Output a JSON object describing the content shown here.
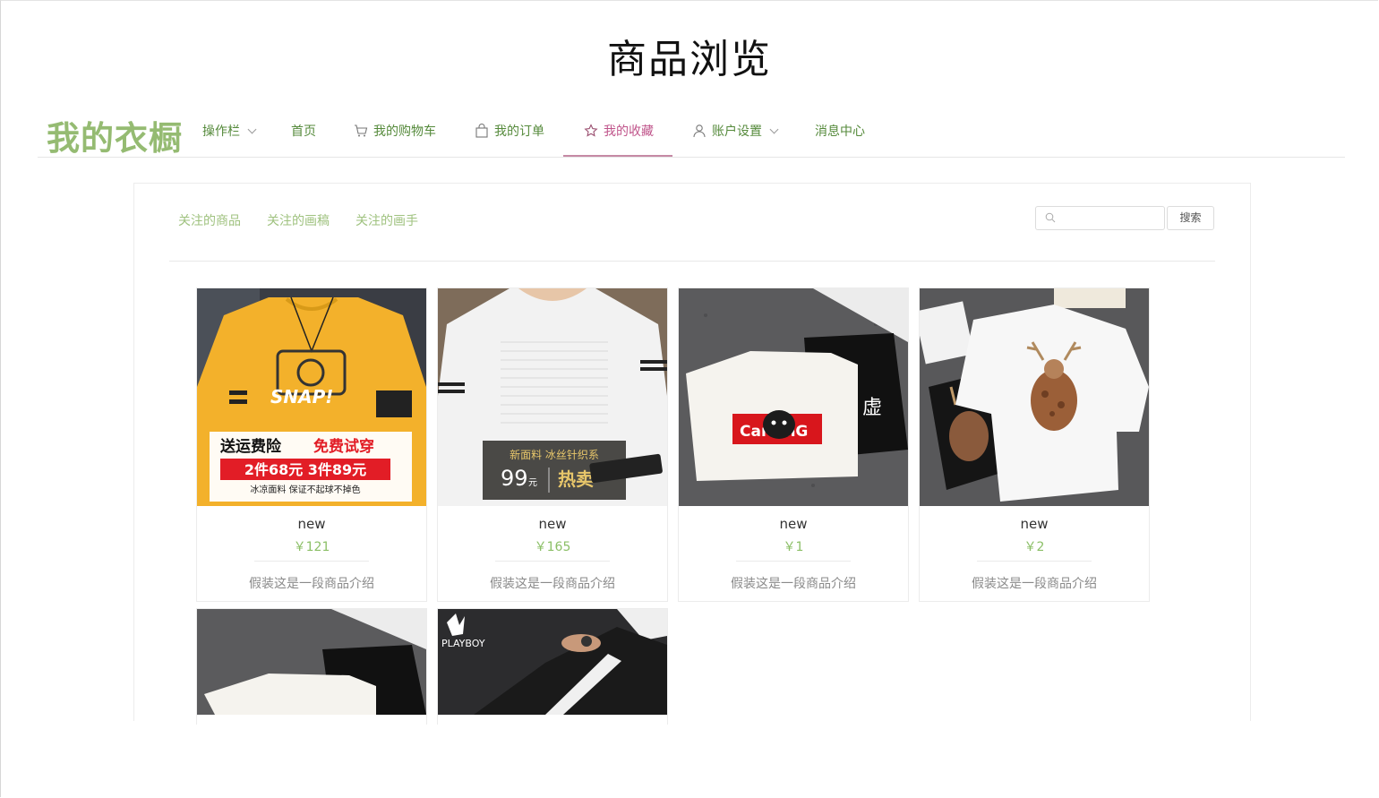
{
  "page_title": "商品浏览",
  "nav": {
    "logo": "我的衣橱",
    "items": [
      {
        "label": "操作栏",
        "icon": "",
        "dropdown": true
      },
      {
        "label": "首页",
        "icon": ""
      },
      {
        "label": "我的购物车",
        "icon": "cart-icon"
      },
      {
        "label": "我的订单",
        "icon": "bag-icon"
      },
      {
        "label": "我的收藏",
        "icon": "star-icon",
        "active": true
      },
      {
        "label": "账户设置",
        "icon": "user-icon",
        "dropdown": true
      },
      {
        "label": "消息中心",
        "icon": ""
      }
    ]
  },
  "subtabs": [
    "关注的商品",
    "关注的画稿",
    "关注的画手"
  ],
  "search": {
    "placeholder": "",
    "button": "搜索"
  },
  "products": [
    {
      "name": "new",
      "price": "￥121",
      "desc": "假装这是一段商品介绍",
      "image_text": {
        "banner1": "送运费险",
        "banner2": "免费试穿",
        "promo": "2件68元 3件89元",
        "note": "冰凉面料 保证不起球不掉色",
        "print": "SNAP!"
      }
    },
    {
      "name": "new",
      "price": "￥165",
      "desc": "假装这是一段商品介绍",
      "image_text": {
        "line1": "新面料 冰丝针织系",
        "price": "99",
        "unit": "元",
        "hot": "热卖"
      }
    },
    {
      "name": "new",
      "price": "￥1",
      "desc": "假装这是一段商品介绍",
      "image_text": {
        "logo": "CarbinG"
      }
    },
    {
      "name": "new",
      "price": "￥2",
      "desc": "假装这是一段商品介绍",
      "image_text": {}
    },
    {
      "name": "",
      "price": "",
      "desc": "",
      "image_text": {}
    },
    {
      "name": "",
      "price": "",
      "desc": "",
      "image_text": {
        "brand": "PLAYBOY"
      }
    }
  ],
  "colors": {
    "accent_green": "#8bbf66",
    "nav_green": "#558a3b",
    "active_pink": "#c0558b"
  }
}
